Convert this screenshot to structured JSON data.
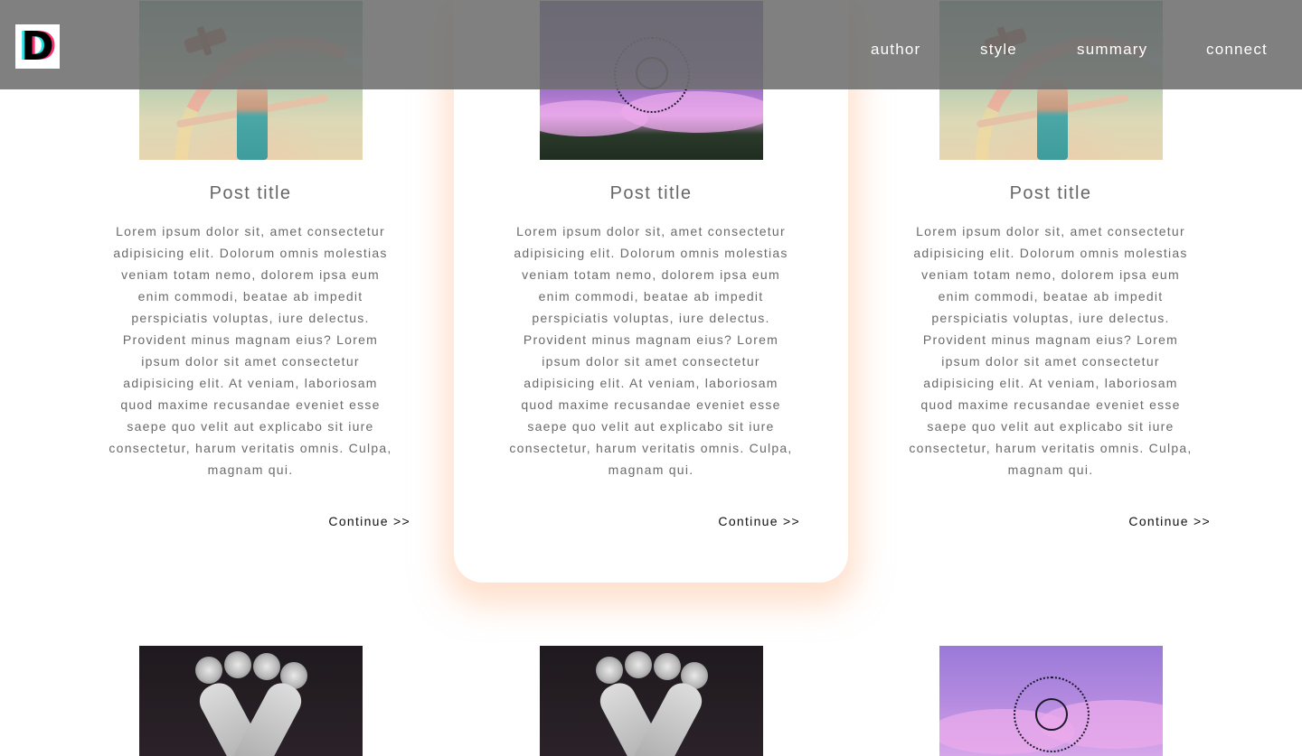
{
  "header": {
    "logo_letter": "D",
    "nav": [
      "author",
      "style",
      "summary",
      "connect"
    ]
  },
  "posts": [
    {
      "image": "girl-rainbow-plane",
      "title": "Post title",
      "body_lines": [
        "Lorem ipsum dolor sit, amet consectetur",
        "adipisicing elit. Dolorum omnis molestias",
        "veniam totam nemo, dolorem ipsa eum",
        "enim commodi, beatae ab impedit",
        "perspiciatis voluptas, iure delectus.",
        "Provident minus magnam eius? Lorem",
        "ipsum dolor sit amet consectetur",
        "adipisicing elit. At veniam, laboriosam",
        "quod maxime recusandae eveniet esse",
        "saepe quo velit aut explicabo sit iure",
        "consectetur, harum veritatis omnis. Culpa,",
        "magnam qui."
      ],
      "continue_label": "Continue >>"
    },
    {
      "image": "purple-sky-celestial",
      "title": "Post title",
      "body_lines": [
        "Lorem ipsum dolor sit, amet consectetur",
        "adipisicing elit. Dolorum omnis molestias",
        "veniam totam nemo, dolorem ipsa eum",
        "enim commodi, beatae ab impedit",
        "perspiciatis voluptas, iure delectus.",
        "Provident minus magnam eius? Lorem",
        "ipsum dolor sit amet consectetur",
        "adipisicing elit. At veniam, laboriosam",
        "quod maxime recusandae eveniet esse",
        "saepe quo velit aut explicabo sit iure",
        "consectetur, harum veritatis omnis. Culpa,",
        "magnam qui."
      ],
      "continue_label": "Continue >>"
    },
    {
      "image": "girl-rainbow-plane",
      "title": "Post title",
      "body_lines": [
        "Lorem ipsum dolor sit, amet consectetur",
        "adipisicing elit. Dolorum omnis molestias",
        "veniam totam nemo, dolorem ipsa eum",
        "enim commodi, beatae ab impedit",
        "perspiciatis voluptas, iure delectus.",
        "Provident minus magnam eius? Lorem",
        "ipsum dolor sit amet consectetur",
        "adipisicing elit. At veniam, laboriosam",
        "quod maxime recusandae eveniet esse",
        "saepe quo velit aut explicabo sit iure",
        "consectetur, harum veritatis omnis. Culpa,",
        "magnam qui."
      ],
      "continue_label": "Continue >>"
    }
  ],
  "second_row_images": [
    "hands-flower-crown",
    "hands-flower-crown",
    "purple-sky-celestial"
  ],
  "colors": {
    "header_overlay": "#6e6e6e",
    "focus_glow": "#ffc4a0",
    "logo_cyan": "#22e0e8",
    "logo_magenta": "#ff2f6e"
  }
}
